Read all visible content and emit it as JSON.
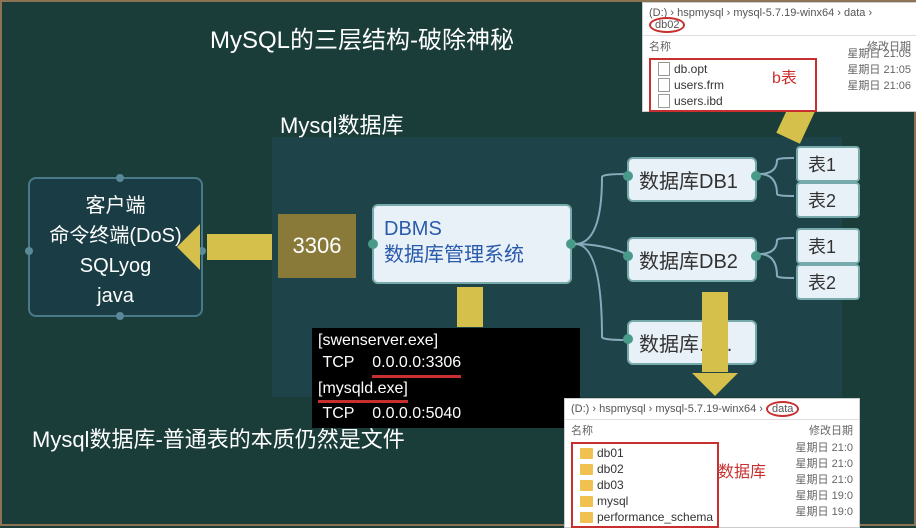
{
  "title": "MySQL的三层结构-破除神秘",
  "conclusion": "Mysql数据库-普通表的本质仍然是文件",
  "mysql_label": "Mysql数据库",
  "client": {
    "line1": "客户端",
    "line2": "命令终端(DoS)",
    "line3": "SQLyog",
    "line4": "java"
  },
  "port": "3306",
  "dbms": {
    "line1": "DBMS",
    "line2": "数据库管理系统"
  },
  "databases": {
    "db1": "数据库DB1",
    "db2": "数据库DB2",
    "db3": "数据库......"
  },
  "tables": {
    "t1": "表1",
    "t2": "表2",
    "t3": "表1",
    "t4": "表2"
  },
  "netstat": {
    "l1": "[swenserver.exe]",
    "l2a": "TCP",
    "l2b": "0.0.0.0:3306",
    "l3": "[mysqld.exe]",
    "l4a": "TCP",
    "l4b": "0.0.0.0:5040"
  },
  "explorer1": {
    "path_prefix": "(D:) › hspmysql › mysql-5.7.19-winx64 › data ›",
    "path_last": "db02",
    "col1": "名称",
    "col2": "修改日期",
    "files": [
      {
        "name": "db.opt",
        "date": "星期日 21:05"
      },
      {
        "name": "users.frm",
        "date": "星期日 21:05"
      },
      {
        "name": "users.ibd",
        "date": "星期日 21:06"
      }
    ],
    "annotation": "b表"
  },
  "explorer2": {
    "path_prefix": "(D:) › hspmysql › mysql-5.7.19-winx64 ›",
    "path_last": "data",
    "col1": "名称",
    "col2": "修改日期",
    "folders": [
      {
        "name": "db01",
        "date": "星期日 21:0"
      },
      {
        "name": "db02",
        "date": "星期日 21:0"
      },
      {
        "name": "db03",
        "date": "星期日 21:0"
      },
      {
        "name": "mysql",
        "date": "星期日 19:0"
      },
      {
        "name": "performance_schema",
        "date": "星期日 19:0"
      }
    ],
    "annotation": "数据库"
  }
}
